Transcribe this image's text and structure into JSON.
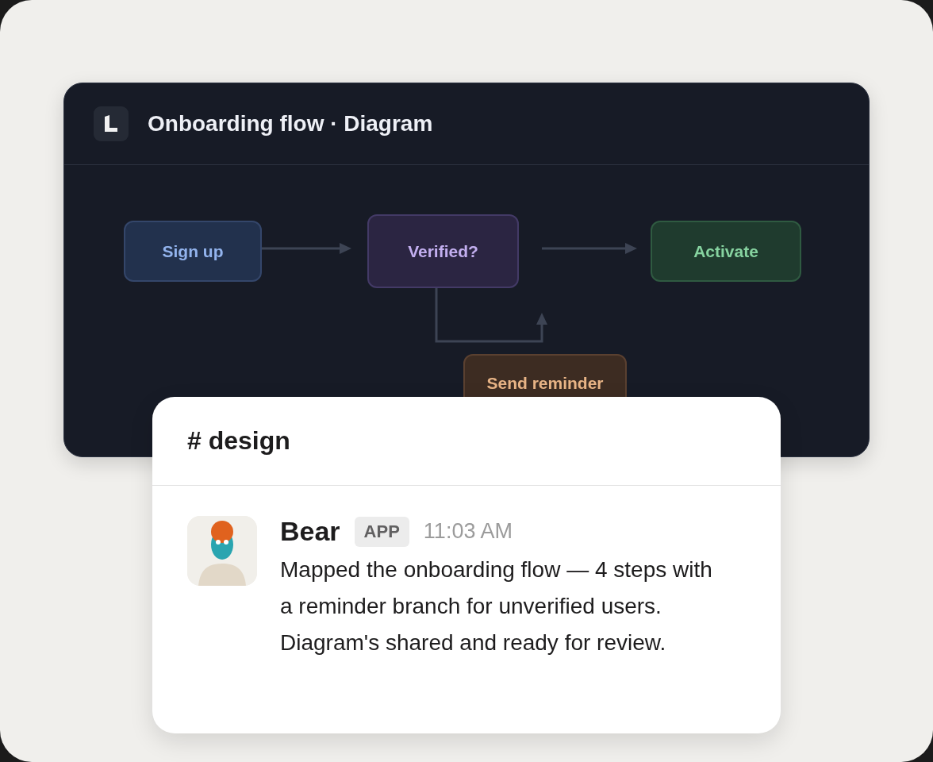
{
  "diagram_window": {
    "title": "Onboarding flow · Diagram",
    "nodes": [
      {
        "label": "Sign up",
        "kind": "start"
      },
      {
        "label": "Verified?",
        "kind": "decision"
      },
      {
        "label": "Activate",
        "kind": "end"
      },
      {
        "label": "Send reminder",
        "kind": "action"
      }
    ]
  },
  "chat": {
    "channel": "# design",
    "message": {
      "author": "Bear",
      "badge": "APP",
      "time": "11:03 AM",
      "text": "Mapped the onboarding flow — 4 steps with a reminder branch for unverified users. Diagram's shared and ready for review."
    }
  }
}
